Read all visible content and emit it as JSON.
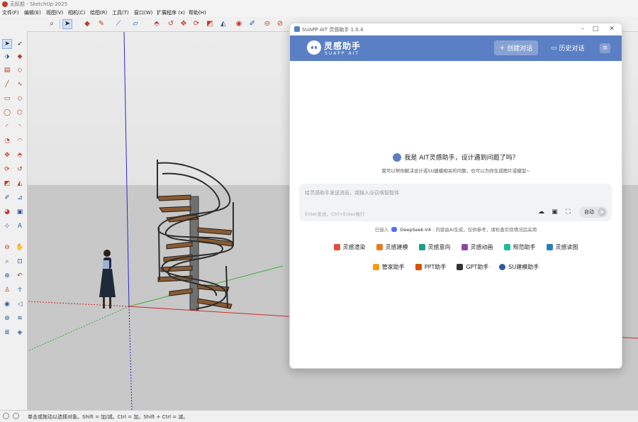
{
  "app": {
    "title": "无标题 - SketchUp 2025"
  },
  "menu": [
    "文件(F)",
    "编辑(E)",
    "视图(V)",
    "相机(C)",
    "绘图(R)",
    "工具(T)",
    "窗口(W)",
    "扩展程序 (x)",
    "帮助(H)"
  ],
  "status": {
    "text": "单击或拖动以选择对象。Shift = 加/减。Ctrl = 加。Shift + Ctrl = 减。"
  },
  "plugin": {
    "window_title": "SUAPP AIT 灵感助手 1.0.4",
    "logo_cn": "灵感助手",
    "logo_en": "SUAPP AIT",
    "new_chat": "创建对话",
    "history": "历史对话",
    "greeting": "我是 AIT灵感助手，设计遇到问题了吗？",
    "subgreeting": "我可以帮你解决设计或SU建模相关的问题，也可以为你生成图片或模型~",
    "input_placeholder": "给灵感助手发送消息，或输入@召唤智能体",
    "input_hint": "Enter发送，Ctrl+Enter换行",
    "auto_label": "自动",
    "model_prefix": "已接入",
    "model_name": "DeepSeek-V4",
    "model_suffix": "内容由AI生成，仅供参考，请检查实际情况后采用",
    "chips_row1": [
      {
        "label": "灵感渲染",
        "color": "#e74c3c"
      },
      {
        "label": "灵感建模",
        "color": "#e67e22"
      },
      {
        "label": "灵感意向",
        "color": "#16a085"
      },
      {
        "label": "灵感动画",
        "color": "#8e44ad"
      },
      {
        "label": "规范助手",
        "color": "#1abc9c"
      },
      {
        "label": "灵感读图",
        "color": "#2980b9"
      }
    ],
    "chips_row2": [
      {
        "label": "管家助手",
        "color": "#f39c12"
      },
      {
        "label": "PPT助手",
        "color": "#d35400"
      },
      {
        "label": "GPT助手",
        "color": "#333333"
      },
      {
        "label": "SU建模助手",
        "color": "#2c5aa0"
      }
    ]
  }
}
